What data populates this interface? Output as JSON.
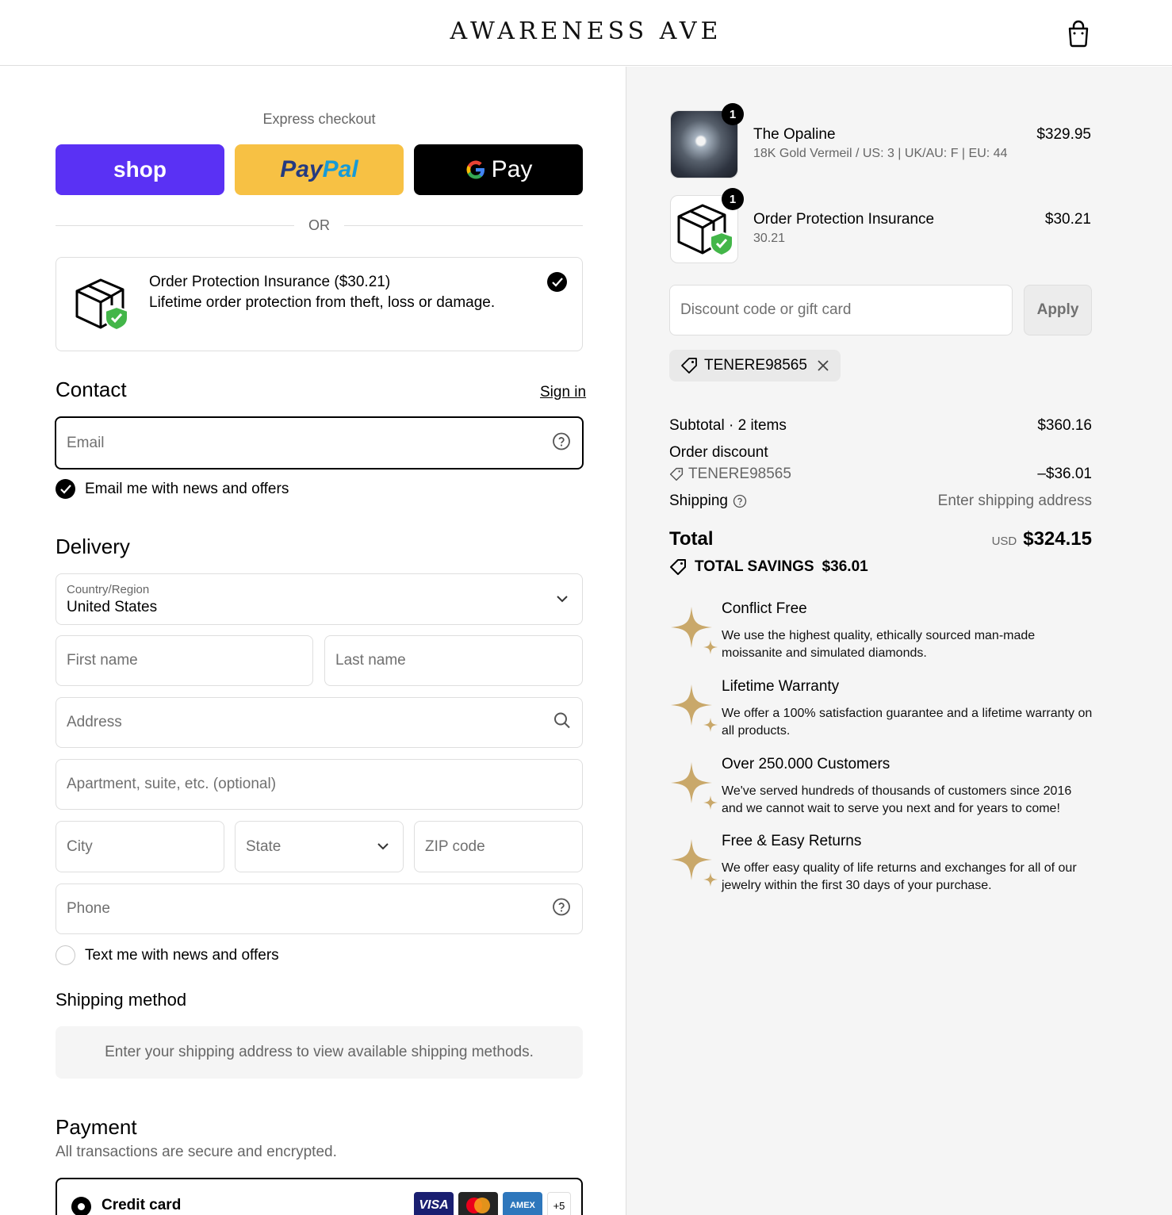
{
  "header": {
    "brand": "AWARENESS AVE",
    "cart_icon": "shopping-bag-icon"
  },
  "express": {
    "title": "Express checkout",
    "shop_label": "shop",
    "paypal_label_1": "Pay",
    "paypal_label_2": "Pal",
    "gpay_label": "Pay",
    "or": "OR"
  },
  "protection": {
    "title": "Order Protection Insurance ($30.21)",
    "description": "Lifetime order protection from theft, loss or damage.",
    "checked": true
  },
  "contact": {
    "title": "Contact",
    "sign_in": "Sign in",
    "email_placeholder": "Email",
    "news_label": "Email me with news and offers"
  },
  "delivery": {
    "title": "Delivery",
    "country_label": "Country/Region",
    "country_value": "United States",
    "first_name_placeholder": "First name",
    "last_name_placeholder": "Last name",
    "address_placeholder": "Address",
    "apartment_placeholder": "Apartment, suite, etc. (optional)",
    "city_placeholder": "City",
    "state_placeholder": "State",
    "zip_placeholder": "ZIP code",
    "phone_placeholder": "Phone",
    "sms_label": "Text me with news and offers"
  },
  "shipping_method": {
    "title": "Shipping method",
    "info": "Enter your shipping address to view available shipping methods."
  },
  "payment": {
    "title": "Payment",
    "subtitle": "All transactions are secure and encrypted.",
    "option_label": "Credit card",
    "cards": [
      "VISA",
      "AMEX"
    ],
    "more": "+5"
  },
  "summary": {
    "items": [
      {
        "qty": "1",
        "name": "The Opaline",
        "variant": "18K Gold Vermeil / US: 3 | UK/AU: F | EU: 44",
        "price": "$329.95"
      },
      {
        "qty": "1",
        "name": "Order Protection Insurance",
        "variant": "30.21",
        "price": "$30.21"
      }
    ],
    "discount_placeholder": "Discount code or gift card",
    "apply_label": "Apply",
    "applied_code": "TENERE98565",
    "subtotal_label": "Subtotal · 2 items",
    "subtotal_value": "$360.16",
    "order_discount_label": "Order discount",
    "discount_code": "TENERE98565",
    "discount_value": "–$36.01",
    "shipping_label": "Shipping",
    "shipping_value": "Enter shipping address",
    "total_label": "Total",
    "total_currency": "USD",
    "total_value": "$324.15",
    "savings_label": "TOTAL SAVINGS",
    "savings_value": "$36.01"
  },
  "features": [
    {
      "title": "Conflict Free",
      "desc": "We use the highest quality, ethically sourced man-made moissanite and simulated diamonds."
    },
    {
      "title": "Lifetime Warranty",
      "desc": "We offer a 100% satisfaction guarantee and a lifetime warranty on all products."
    },
    {
      "title": "Over 250.000 Customers",
      "desc": "We've served hundreds of thousands of customers since 2016 and we cannot wait to serve you next and for years to come!"
    },
    {
      "title": "Free & Easy Returns",
      "desc": "We offer easy quality of life returns and exchanges for all of our jewelry within the first 30 days of your purchase."
    }
  ],
  "colors": {
    "shop": "#5a31f4",
    "paypal": "#f7c144",
    "gpay": "#000000",
    "shield_green": "#43b649",
    "star_gold": "#c9a86a"
  }
}
